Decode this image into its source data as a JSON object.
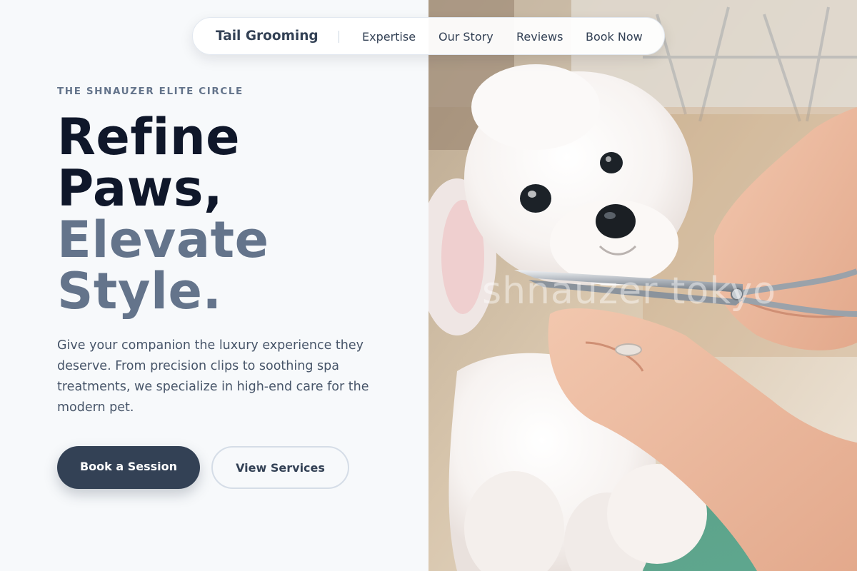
{
  "nav": {
    "brand": "Tail Grooming",
    "links": [
      "Expertise",
      "Our Story",
      "Reviews",
      "Book Now"
    ]
  },
  "hero": {
    "eyebrow": "THE SHNAUZER ELITE CIRCLE",
    "headline": {
      "line1": "Refine",
      "line2": "Paws,",
      "line3": "Elevate",
      "line4": "Style."
    },
    "description": "Give your companion the luxury experience they deserve. From precision clips to soothing spa treatments, we specialize in high-end care for the modern pet.",
    "primary_button": "Book a Session",
    "secondary_button": "View Services"
  },
  "image": {
    "watermark": "shnauzer tokyo"
  },
  "colors": {
    "background": "#f7f9fb",
    "heading_dark": "#0f172a",
    "heading_muted": "#64748b",
    "primary_button": "#334155",
    "body_text": "#475569"
  }
}
